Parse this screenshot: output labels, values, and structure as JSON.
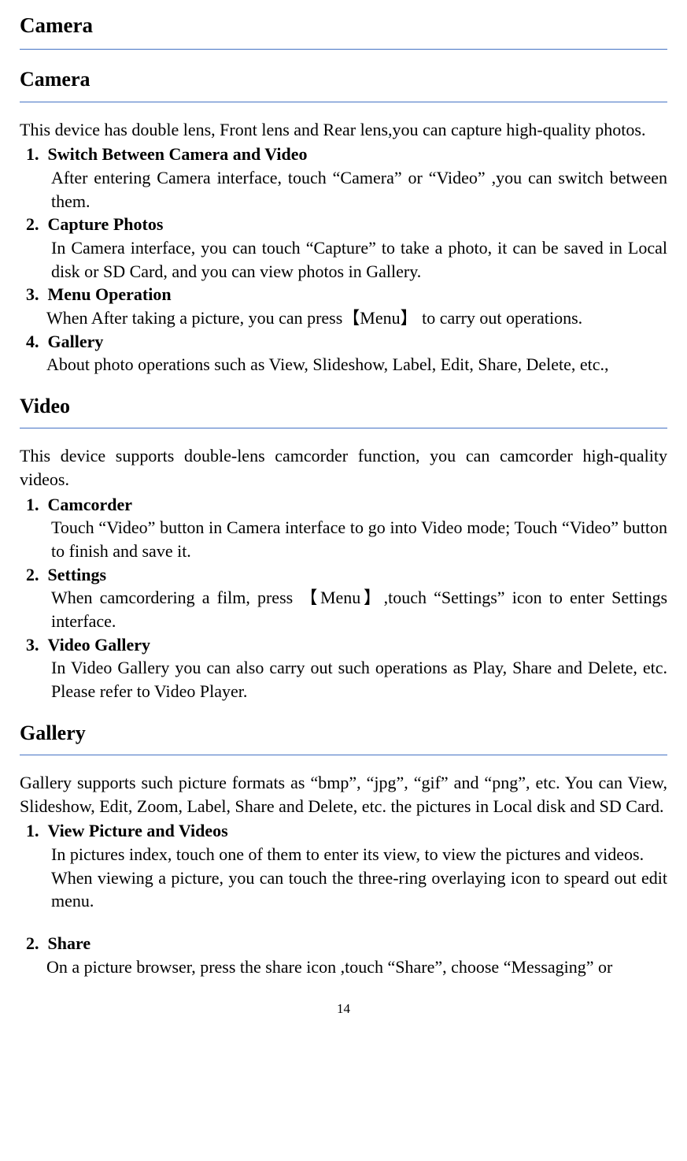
{
  "page_title": "Camera",
  "camera": {
    "heading": "Camera",
    "intro": "This device has double lens, Front lens and Rear lens,you can capture high-quality photos.",
    "items": [
      {
        "num": "1.",
        "title": "Switch Between Camera and Video",
        "body": "After entering Camera interface, touch “Camera” or “Video” ,you can switch between them."
      },
      {
        "num": "2.",
        "title": "Capture Photos",
        "body": "In Camera interface, you can touch “Capture” to take a photo, it can be saved in Local disk or SD Card, and you can view photos in Gallery."
      },
      {
        "num": "3.",
        "title": "Menu Operation",
        "body": "When After taking a picture, you can press【Menu】  to carry out operations."
      },
      {
        "num": "4.",
        "title": "Gallery",
        "body": "About photo operations such as View, Slideshow, Label, Edit, Share, Delete, etc.,"
      }
    ]
  },
  "video": {
    "heading": "Video",
    "intro": "This device supports double-lens camcorder function, you can camcorder high-quality videos.",
    "items": [
      {
        "num": "1.",
        "title": "Camcorder",
        "body": "Touch “Video” button in Camera interface to go into Video mode; Touch “Video” button to finish and save it."
      },
      {
        "num": "2.",
        "title": "Settings",
        "body": "When camcordering a film, press 【Menu】,touch “Settings” icon to enter Settings interface."
      },
      {
        "num": "3.",
        "title": "Video Gallery",
        "body": "In Video Gallery you can also carry out such operations as Play, Share and Delete, etc. Please refer to Video Player."
      }
    ]
  },
  "gallery": {
    "heading": "Gallery",
    "intro": "Gallery supports such picture formats as “bmp”, “jpg”, “gif” and “png”, etc. You can View, Slideshow, Edit, Zoom, Label, Share and Delete, etc. the pictures in Local disk and SD Card.",
    "items": [
      {
        "num": "1.",
        "title": "View Picture and Videos",
        "body1": "In pictures index, touch one of them to enter its view, to view the pictures and videos.",
        "body2": "When viewing a picture, you can touch the three-ring overlaying icon to speard out edit menu."
      },
      {
        "num": "2.",
        "title": "Share",
        "body": "On a picture browser, press the share icon ,touch “Share”, choose “Messaging” or"
      }
    ]
  },
  "page_number": "14"
}
